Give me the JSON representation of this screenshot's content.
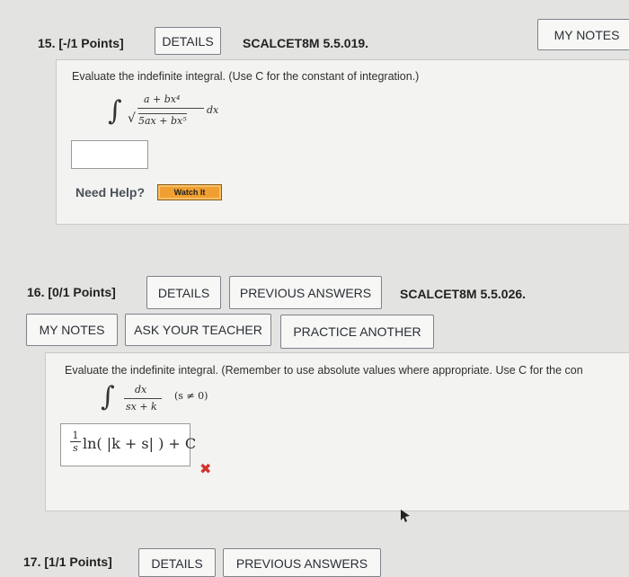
{
  "q15": {
    "number": "15.",
    "points": "[-/1 Points]",
    "details_label": "DETAILS",
    "code": "SCALCET8M 5.5.019.",
    "my_notes_label": "MY NOTES",
    "prompt": "Evaluate the indefinite integral. (Use C for the constant of integration.)",
    "integral": {
      "numerator": "a + bx⁴",
      "denominator": "5ax + bx⁵",
      "dx": "dx"
    },
    "answer_value": "",
    "need_help": "Need Help?",
    "watch_label": "Watch It"
  },
  "q16": {
    "number": "16.",
    "points": "[0/1 Points]",
    "details_label": "DETAILS",
    "previous_answers_label": "PREVIOUS ANSWERS",
    "code": "SCALCET8M 5.5.026.",
    "my_notes_label": "MY NOTES",
    "ask_teacher_label": "ASK YOUR TEACHER",
    "practice_another_label": "PRACTICE ANOTHER",
    "prompt": "Evaluate the indefinite integral. (Remember to use absolute values where appropriate. Use C for the con",
    "integral": {
      "numerator": "dx",
      "denominator": "sx + k",
      "condition": "(s ≠ 0)"
    },
    "answer": {
      "frac_num": "1",
      "frac_den": "s",
      "body": "ln( |k + s| ) + C"
    },
    "status": "incorrect"
  },
  "q17": {
    "number": "17.",
    "points": "[1/1 Points]",
    "details_label": "DETAILS",
    "previous_answers_label": "PREVIOUS ANSWERS"
  }
}
